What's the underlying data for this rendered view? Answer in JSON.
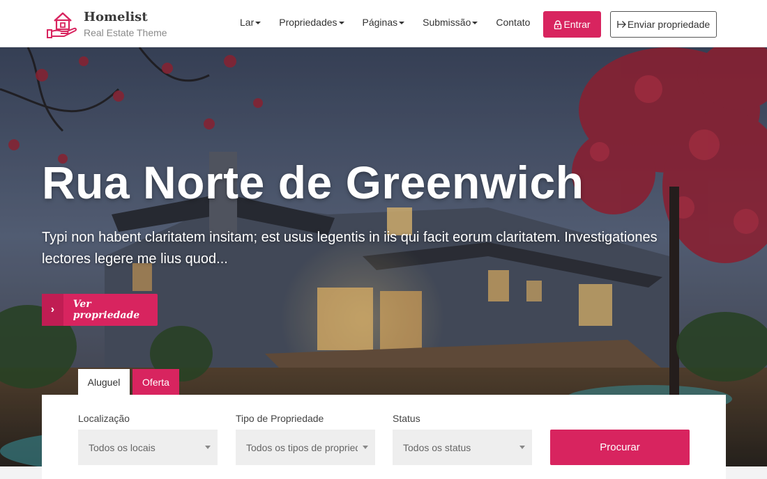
{
  "brand": {
    "name": "Homelist",
    "tagline": "Real Estate Theme",
    "accent": "#d8245f"
  },
  "nav": {
    "items": [
      {
        "label": "Lar",
        "has_dropdown": true
      },
      {
        "label": "Propriedades",
        "has_dropdown": true
      },
      {
        "label": "Páginas",
        "has_dropdown": true
      },
      {
        "label": "Submissão",
        "has_dropdown": true
      },
      {
        "label": "Contato",
        "has_dropdown": false
      }
    ],
    "login_label": "Entrar",
    "login_icon": "lock-icon",
    "submit_label": "Enviar propriedade",
    "submit_icon": "arrow-right-icon"
  },
  "hero": {
    "title": "Rua Norte de Greenwich",
    "description": "Typi non habent claritatem insitam; est usus legentis in iis qui facit eorum claritatem. Investigationes lectores legere me lius quod...",
    "cta_label": "Ver propriedade",
    "cta_icon": "chevron-right-icon"
  },
  "search": {
    "tabs": [
      {
        "label": "Aluguel",
        "active": true
      },
      {
        "label": "Oferta",
        "active": false
      }
    ],
    "fields": [
      {
        "label": "Localização",
        "value": "Todos os locais"
      },
      {
        "label": "Tipo de Propriedade",
        "value": "Todos os tipos de propriedade"
      },
      {
        "label": "Status",
        "value": "Todos os status"
      }
    ],
    "button_label": "Procurar"
  }
}
